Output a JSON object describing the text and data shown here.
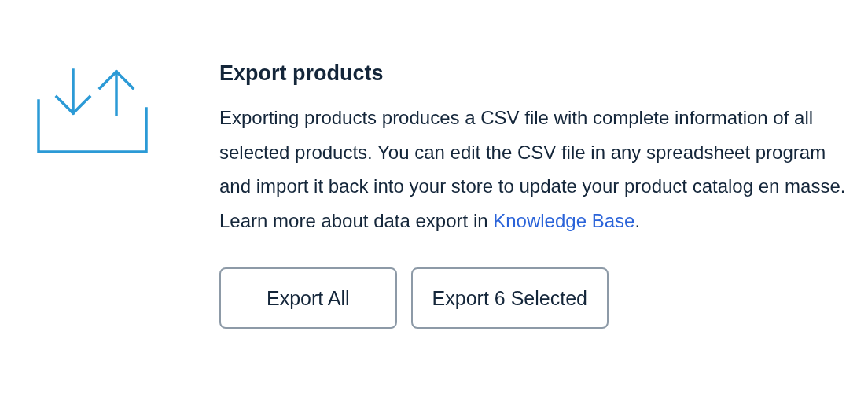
{
  "title": "Export products",
  "description": {
    "text": "Exporting products produces a CSV file with complete information of all selected products. You can edit the CSV file in any spreadsheet program and import it back into your store to update your product catalog en masse. Learn more about data export in ",
    "link": "Knowledge Base",
    "after": "."
  },
  "buttons": [
    {
      "label": "Export All"
    },
    {
      "label": "Export 6 Selected"
    }
  ]
}
